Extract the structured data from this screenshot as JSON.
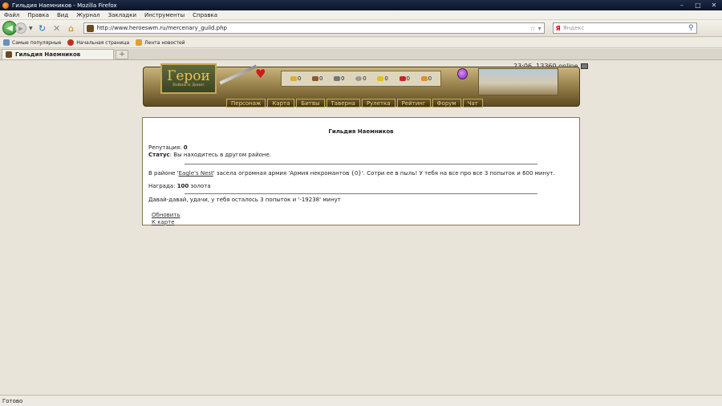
{
  "window": {
    "title": "Гильдия Наемников - Mozilla Firefox"
  },
  "menu": [
    "Файл",
    "Правка",
    "Вид",
    "Журнал",
    "Закладки",
    "Инструменты",
    "Справка"
  ],
  "url": "http://www.heroeswm.ru/mercenary_guild.php",
  "search": {
    "placeholder": "Яндекс"
  },
  "bookmarks": [
    "Самые популярные",
    "Начальная страница",
    "Лента новостей"
  ],
  "tab": {
    "title": "Гильдия Наемников"
  },
  "status": "Готово",
  "game": {
    "online": "23:06, 13360 online",
    "logo": "Герои",
    "logo_sub": "Войны и Денег",
    "resources": [
      "0",
      "0",
      "0",
      "0",
      "0",
      "0",
      "0"
    ],
    "nav": [
      "Персонаж",
      "Карта",
      "Битвы",
      "Таверна",
      "Рулетка",
      "Рейтинг",
      "Форум",
      "Чат"
    ]
  },
  "guild": {
    "title": "Гильдия Наемников",
    "reputation_label": "Репутация:",
    "reputation_value": "0",
    "status_label": "Статус",
    "status_text": ": Вы находитесь в другом районе.",
    "mission_pre": "В районе '",
    "mission_location": "Eagle's Nest",
    "mission_post": "' засела огромная армия 'Армия некромантов {0}'. Сотри ее в пыль! У тебя на все про все 3 попыток и 600 минут.",
    "reward_label": "Награда: ",
    "reward_value": "100",
    "reward_unit": " золота",
    "remaining": "Давай-давай, удачи, у тебя осталось 3 попыток и '-19238' минут",
    "refresh": "Обновить",
    "to_map": "К карте"
  }
}
